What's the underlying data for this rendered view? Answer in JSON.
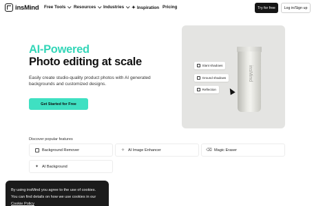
{
  "nav": {
    "brand": "insMind",
    "items": [
      {
        "label": "Free Tools",
        "dropdown": true
      },
      {
        "label": "Resources",
        "dropdown": true
      },
      {
        "label": "Industries",
        "dropdown": true
      },
      {
        "label": "Inspiration",
        "dropdown": false
      },
      {
        "label": "Pricing",
        "dropdown": false
      }
    ],
    "try_label": "Try for free",
    "login_label": "Log in/Sign up"
  },
  "hero": {
    "title_accent": "AI-Powered",
    "title_main": "Photo editing at scale",
    "description": "Easily create studio-quality product photos with AI generated backgrounds and customized designs.",
    "cta_label": "Get Started for Free"
  },
  "showcase": {
    "product_brand": "insMind",
    "chips": [
      "Slant shadows",
      "Ground shadows",
      "Reflection"
    ]
  },
  "features": {
    "label": "Discover popular features",
    "items": [
      {
        "label": "Background Remover",
        "icon": "image-remove-icon"
      },
      {
        "label": "AI Image Enhancer",
        "icon": "sparkle-icon"
      },
      {
        "label": "Magic Eraser",
        "icon": "eraser-icon"
      },
      {
        "label": "AI Background",
        "icon": "sparkle-image-icon"
      }
    ]
  },
  "cookie": {
    "line1": "By using insMind you agree to the use of cookies.",
    "line2": "You can find details on how we use cookies in our",
    "line3": "Cookie Policy"
  },
  "colors": {
    "accent": "#3fe0c2",
    "title_accent": "#34d6b8",
    "dark": "#151515"
  }
}
